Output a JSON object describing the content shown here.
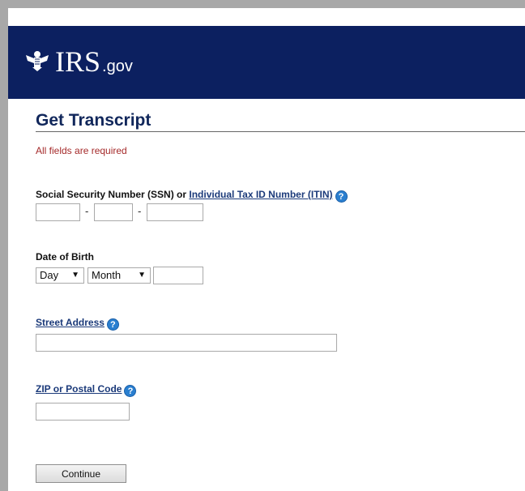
{
  "header": {
    "brand": "IRS",
    "brand_suffix": ".gov",
    "bg_color": "#0c2060"
  },
  "form": {
    "title": "Get Transcript",
    "required_note": "All fields are required",
    "ssn": {
      "label_prefix": "Social Security Number (SSN) or ",
      "label_link": "Individual Tax ID Number (ITIN)",
      "separator": "-"
    },
    "dob": {
      "label": "Date of Birth",
      "day_value": "Day",
      "month_value": "Month"
    },
    "street": {
      "label": "Street Address"
    },
    "zip": {
      "label": "ZIP or Postal Code"
    },
    "continue_label": "Continue"
  },
  "icons": {
    "help": "question-circle-icon",
    "eagle": "irs-eagle-logo"
  },
  "colors": {
    "title": "#11275b",
    "required": "#a52a2a",
    "link": "#1b3a7a",
    "help": "#2a7fd0"
  }
}
